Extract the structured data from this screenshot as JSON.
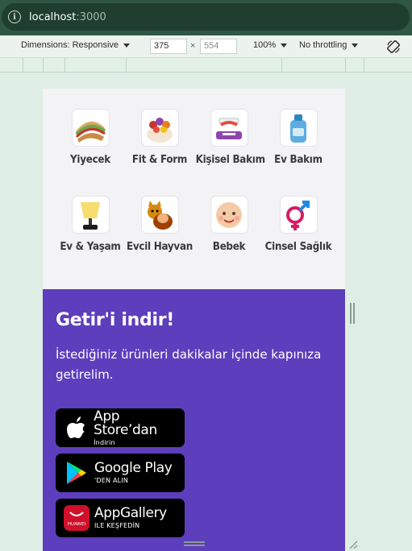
{
  "browser": {
    "url_host": "localhost",
    "url_port": ":3000"
  },
  "devtools": {
    "dimensions_label": "Dimensions: Responsive",
    "width_value": "375",
    "height_placeholder": "554",
    "zoom": "100%",
    "throttling": "No throttling"
  },
  "categories": [
    {
      "label": "Yiyecek",
      "icon": "sandwich-icon"
    },
    {
      "label": "Fit & Form",
      "icon": "fruit-bowl-icon"
    },
    {
      "label": "Kişisel Bakım",
      "icon": "toothpaste-icon"
    },
    {
      "label": "Ev Bakım",
      "icon": "detergent-icon"
    },
    {
      "label": "Ev & Yaşam",
      "icon": "lamp-icon"
    },
    {
      "label": "Evcil Hayvan",
      "icon": "pets-icon"
    },
    {
      "label": "Bebek",
      "icon": "baby-icon"
    },
    {
      "label": "Cinsel Sağlık",
      "icon": "gender-icon"
    }
  ],
  "promo": {
    "title": "Getir'i indir!",
    "text": "İstediğiniz ürünleri dakikalar içinde kapınıza getirelim.",
    "bg_color": "#5d3ebc",
    "buttons": [
      {
        "main": "App Store’dan",
        "sub": "İndirin",
        "icon": "apple-icon"
      },
      {
        "main": "Google Play",
        "sub": "'DEN ALIN",
        "icon": "google-play-icon"
      },
      {
        "main": "AppGallery",
        "sub": "ILE KEŞFEDİN",
        "icon": "huawei-icon",
        "logo_text": "HUAWEI"
      }
    ]
  }
}
